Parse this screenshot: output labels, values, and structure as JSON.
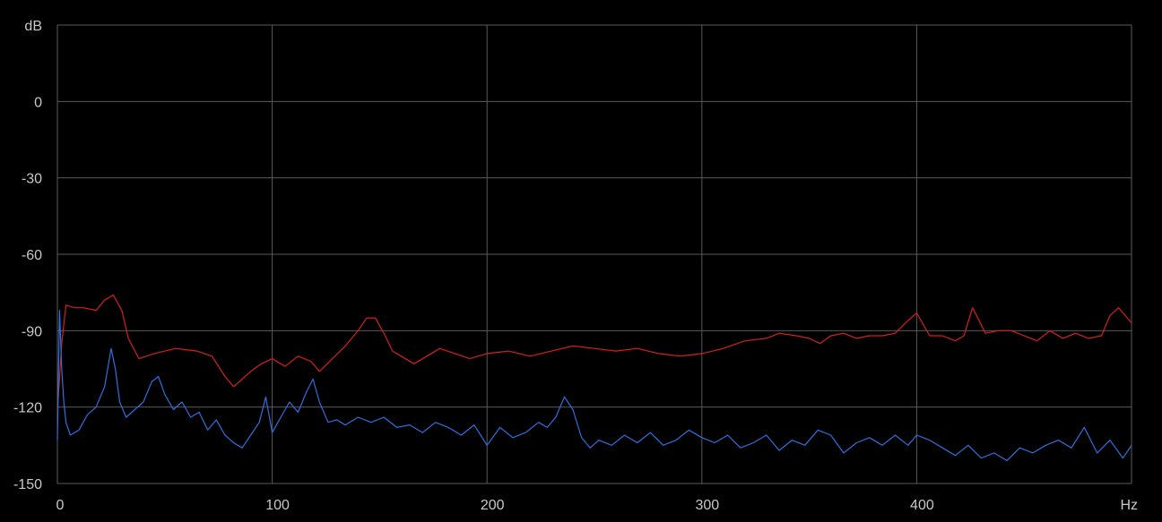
{
  "chart_data": {
    "type": "line",
    "xlabel": "Hz",
    "ylabel": "dB",
    "xlim": [
      0,
      500
    ],
    "ylim": [
      -150,
      30
    ],
    "x_ticks": [
      0,
      100,
      200,
      300,
      400
    ],
    "x_tick_labels": [
      "0",
      "100",
      "200",
      "300",
      "400"
    ],
    "y_ticks": [
      0,
      -30,
      -60,
      -90,
      -120,
      -150
    ],
    "y_tick_labels": [
      "0",
      "-30",
      "-60",
      "-90",
      "-120",
      "-150"
    ],
    "grid": true,
    "colors": {
      "background": "#000000",
      "grid": "#5a5a5a",
      "text": "#c8c8c8"
    },
    "series": [
      {
        "color": "#d42020",
        "x": [
          0,
          2,
          4,
          8,
          12,
          18,
          22,
          26,
          30,
          33,
          38,
          45,
          55,
          65,
          72,
          78,
          82,
          86,
          90,
          95,
          100,
          106,
          112,
          118,
          122,
          128,
          134,
          140,
          144,
          148,
          152,
          156,
          160,
          166,
          172,
          178,
          185,
          192,
          200,
          210,
          220,
          230,
          240,
          250,
          260,
          270,
          280,
          290,
          300,
          310,
          320,
          330,
          336,
          344,
          350,
          355,
          360,
          366,
          372,
          378,
          384,
          390,
          396,
          400,
          406,
          412,
          418,
          422,
          426,
          432,
          438,
          444,
          450,
          456,
          462,
          468,
          474,
          480,
          486,
          490,
          494,
          500
        ],
        "values": [
          -122,
          -95,
          -80,
          -81,
          -81,
          -82,
          -78,
          -76,
          -82,
          -93,
          -101,
          -99,
          -97,
          -98,
          -100,
          -108,
          -112,
          -109,
          -106,
          -103,
          -101,
          -104,
          -100,
          -102,
          -106,
          -101,
          -96,
          -90,
          -85,
          -85,
          -91,
          -98,
          -100,
          -103,
          -100,
          -97,
          -99,
          -101,
          -99,
          -98,
          -100,
          -98,
          -96,
          -97,
          -98,
          -97,
          -99,
          -100,
          -99,
          -97,
          -94,
          -93,
          -91,
          -92,
          -93,
          -95,
          -92,
          -91,
          -93,
          -92,
          -92,
          -91,
          -86,
          -83,
          -92,
          -92,
          -94,
          -92,
          -81,
          -91,
          -90,
          -90,
          -92,
          -94,
          -90,
          -93,
          -91,
          -93,
          -92,
          -84,
          -81,
          -87
        ]
      },
      {
        "color": "#2e6fe0",
        "x": [
          0,
          1,
          2,
          3,
          4,
          6,
          10,
          14,
          18,
          22,
          25,
          27,
          29,
          32,
          36,
          40,
          44,
          47,
          50,
          54,
          58,
          62,
          66,
          70,
          74,
          78,
          82,
          86,
          90,
          94,
          97,
          100,
          104,
          108,
          112,
          116,
          119,
          122,
          126,
          130,
          134,
          140,
          146,
          152,
          158,
          164,
          170,
          176,
          182,
          188,
          194,
          200,
          206,
          212,
          218,
          224,
          228,
          232,
          236,
          240,
          244,
          248,
          252,
          258,
          264,
          270,
          276,
          282,
          288,
          294,
          300,
          306,
          312,
          318,
          324,
          330,
          336,
          342,
          348,
          354,
          360,
          366,
          372,
          378,
          384,
          390,
          396,
          400,
          406,
          412,
          418,
          424,
          430,
          436,
          442,
          448,
          454,
          460,
          466,
          472,
          478,
          484,
          490,
          496,
          500
        ],
        "values": [
          -133,
          -82,
          -105,
          -118,
          -126,
          -131,
          -129,
          -123,
          -120,
          -112,
          -97,
          -105,
          -118,
          -124,
          -121,
          -118,
          -110,
          -108,
          -115,
          -121,
          -118,
          -124,
          -122,
          -129,
          -125,
          -131,
          -134,
          -136,
          -131,
          -126,
          -116,
          -130,
          -124,
          -118,
          -122,
          -114,
          -109,
          -118,
          -126,
          -125,
          -127,
          -124,
          -126,
          -124,
          -128,
          -127,
          -130,
          -126,
          -128,
          -131,
          -127,
          -135,
          -128,
          -132,
          -130,
          -126,
          -128,
          -124,
          -116,
          -121,
          -132,
          -136,
          -133,
          -135,
          -131,
          -134,
          -130,
          -135,
          -133,
          -129,
          -132,
          -134,
          -131,
          -136,
          -134,
          -131,
          -137,
          -133,
          -135,
          -129,
          -131,
          -138,
          -134,
          -132,
          -135,
          -131,
          -135,
          -131,
          -133,
          -136,
          -139,
          -135,
          -140,
          -138,
          -141,
          -136,
          -138,
          -135,
          -133,
          -136,
          -128,
          -138,
          -133,
          -140,
          -135
        ]
      }
    ]
  }
}
